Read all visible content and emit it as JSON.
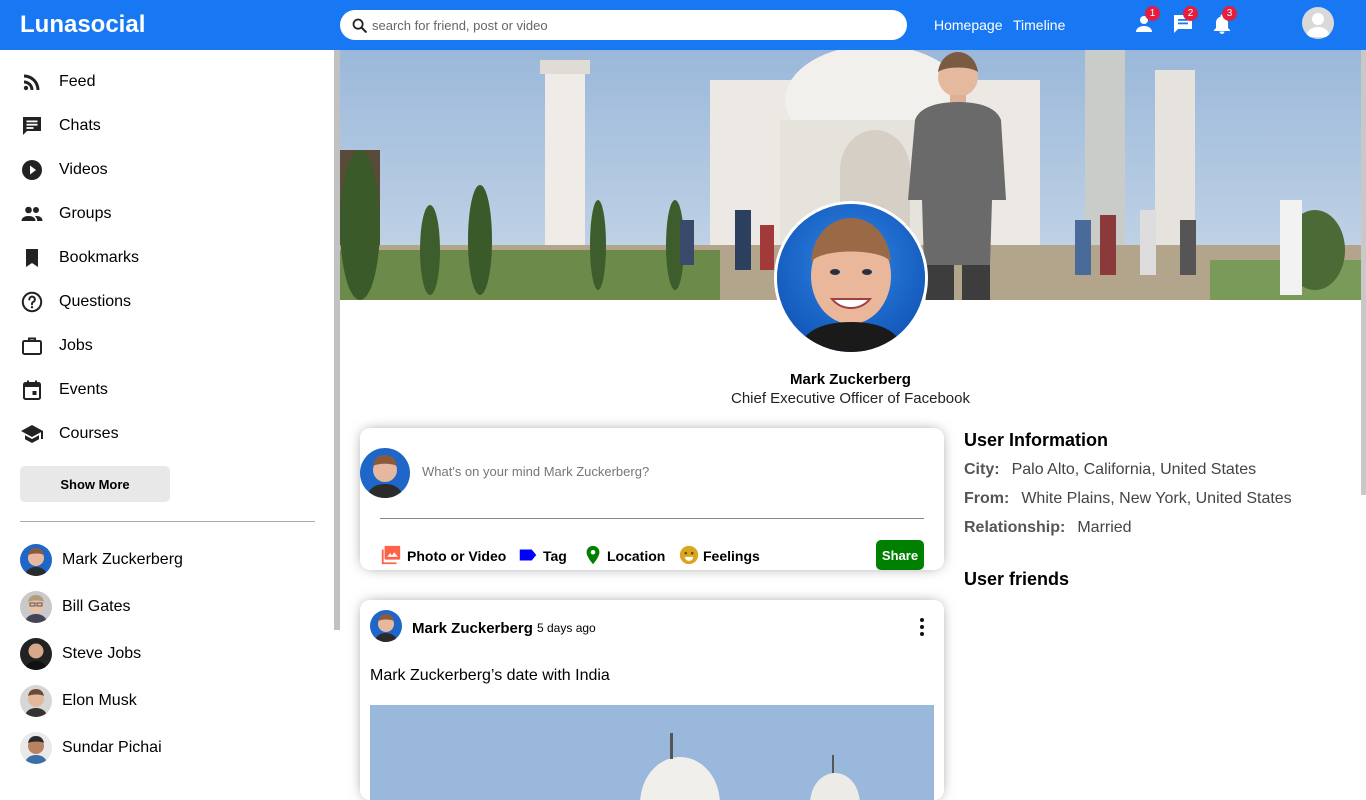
{
  "header": {
    "logo": "Lunasocial",
    "search_placeholder": "search for friend, post or video",
    "links": [
      "Homepage",
      "Timeline"
    ],
    "badges": {
      "person": "1",
      "chat": "2",
      "notifications": "3"
    }
  },
  "sidebar": {
    "items": [
      {
        "label": "Feed",
        "icon": "rss-feed-icon"
      },
      {
        "label": "Chats",
        "icon": "chat-icon"
      },
      {
        "label": "Videos",
        "icon": "play-circle-icon"
      },
      {
        "label": "Groups",
        "icon": "group-icon"
      },
      {
        "label": "Bookmarks",
        "icon": "bookmark-icon"
      },
      {
        "label": "Questions",
        "icon": "help-outline-icon"
      },
      {
        "label": "Jobs",
        "icon": "work-outline-icon"
      },
      {
        "label": "Events",
        "icon": "event-icon"
      },
      {
        "label": "Courses",
        "icon": "school-icon"
      }
    ],
    "show_more": "Show More",
    "friends": [
      "Mark Zuckerberg",
      "Bill Gates",
      "Steve Jobs",
      "Elon Musk",
      "Sundar Pichai"
    ]
  },
  "profile": {
    "name": "Mark Zuckerberg",
    "description": "Chief Executive Officer of Facebook"
  },
  "share": {
    "placeholder": "What's on your mind Mark Zuckerberg?",
    "options": [
      "Photo or Video",
      "Tag",
      "Location",
      "Feelings"
    ],
    "share_button": "Share"
  },
  "post": {
    "username": "Mark Zuckerberg",
    "date": "5 days ago",
    "text": "Mark Zuckerberg’s date with India"
  },
  "user_info": {
    "title": "User Information",
    "city_label": "City:",
    "city": "Palo Alto, California, United States",
    "from_label": "From:",
    "from": "White Plains, New York, United States",
    "relationship_label": "Relationship:",
    "relationship": "Married",
    "friends_title": "User friends"
  },
  "colors": {
    "brand": "#1877f2",
    "share_button": "#008000",
    "badge": "#e41e3f",
    "tag_icon": "#0000ff",
    "location_icon": "#008000",
    "photo_icon": "#ff6347",
    "feelings_icon": "#daa520"
  }
}
